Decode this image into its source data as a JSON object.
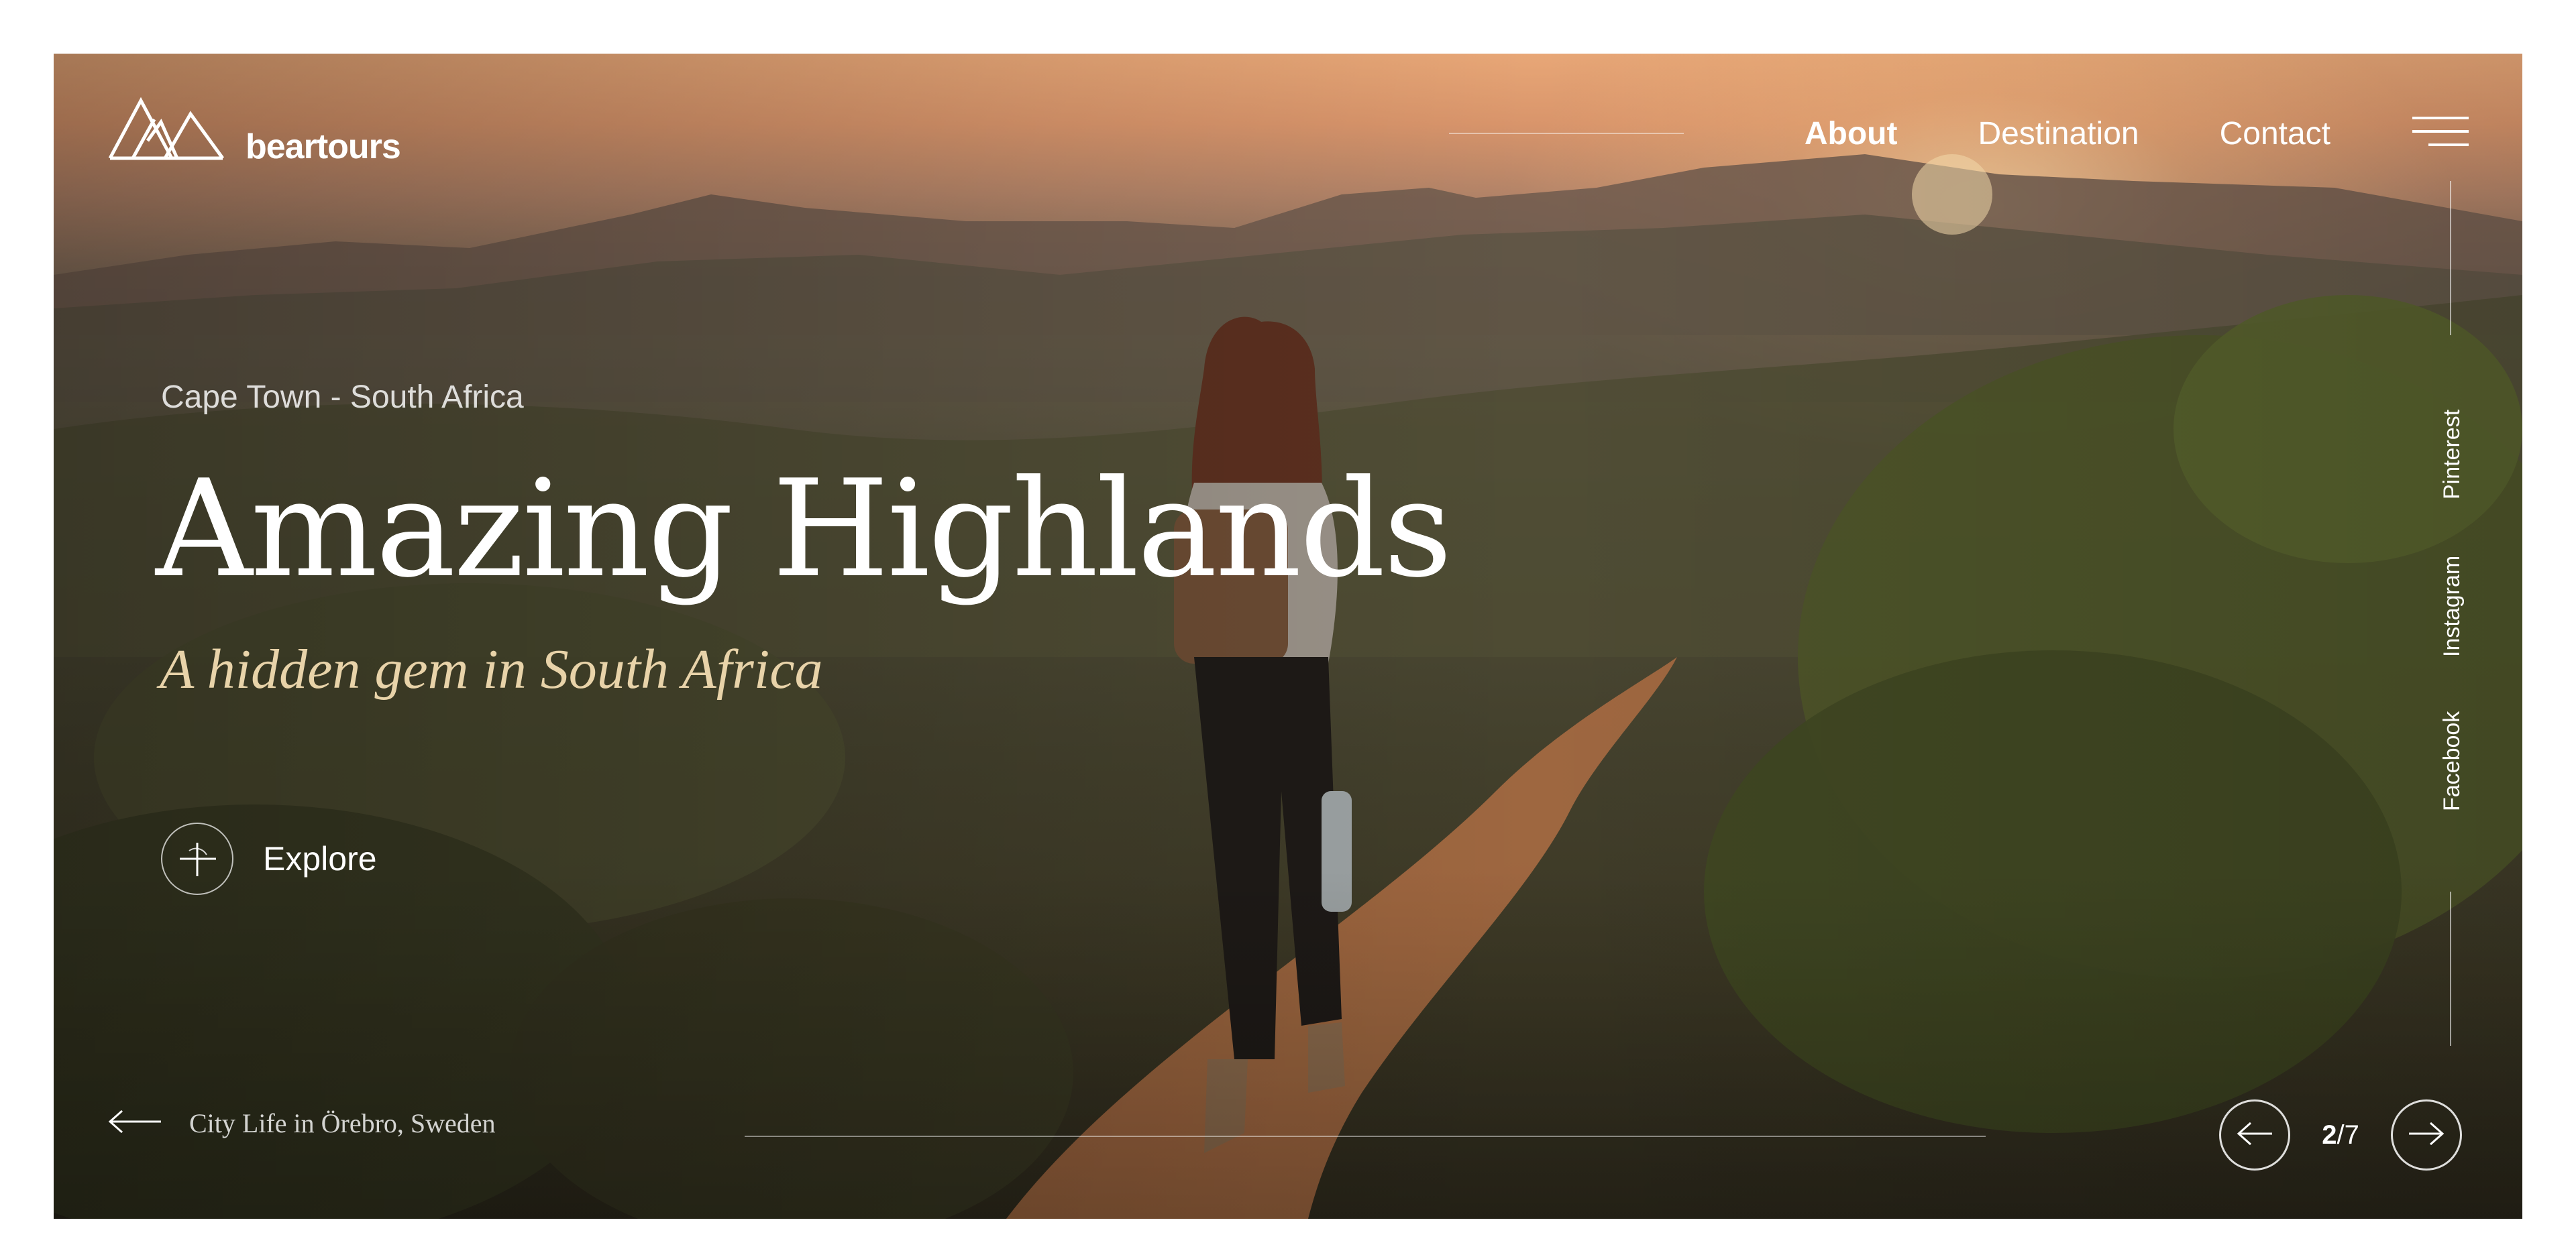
{
  "brand": {
    "name": "beartours",
    "logo_icon": "mountains-logo-icon"
  },
  "nav": {
    "items": [
      {
        "label": "About",
        "active": true
      },
      {
        "label": "Destination",
        "active": false
      },
      {
        "label": "Contact",
        "active": false
      }
    ],
    "menu_icon": "hamburger-menu-icon"
  },
  "social": {
    "items": [
      {
        "label": "Pinterest"
      },
      {
        "label": "Instagram"
      },
      {
        "label": "Facebook"
      }
    ]
  },
  "hero": {
    "location": "Cape Town - South Africa",
    "title": "Amazing Highlands",
    "subtitle": "A hidden gem in South Africa",
    "explore_label": "Explore",
    "explore_icon": "crosshair-icon"
  },
  "footer": {
    "prev_label": "City Life in Örebro, Sweden",
    "prev_icon": "arrow-left-icon",
    "pager": {
      "current": "2",
      "separator": "/",
      "total": "7",
      "prev_icon": "arrow-left-icon",
      "next_icon": "arrow-right-icon"
    }
  },
  "colors": {
    "accent_text": "#e8d3a9",
    "text": "#ffffff",
    "page_background": "#ffffff"
  }
}
